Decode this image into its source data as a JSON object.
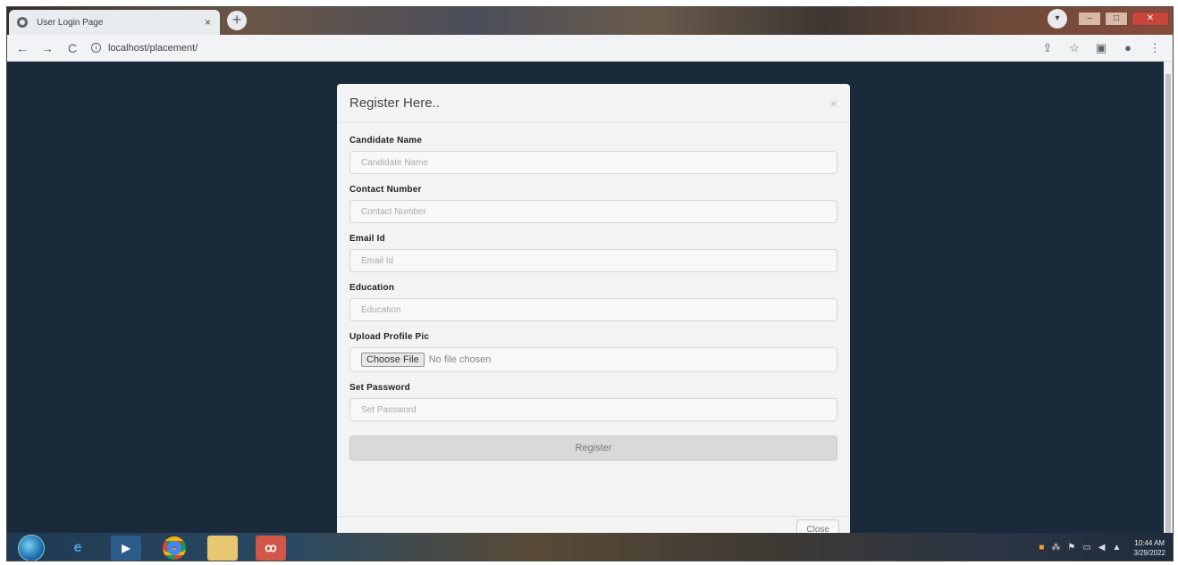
{
  "browser": {
    "tab_title": "User Login Page",
    "tab_close": "×",
    "new_tab": "+",
    "url": "localhost/placement/",
    "nav": {
      "back": "←",
      "forward": "→",
      "reload": "C"
    },
    "window_controls": {
      "minimize": "–",
      "maximize": "□",
      "close": "✕"
    }
  },
  "modal": {
    "title": "Register Here..",
    "close_symbol": "×",
    "fields": [
      {
        "label": "Candidate Name",
        "placeholder": "Candidate Name"
      },
      {
        "label": "Contact Number",
        "placeholder": "Contact Number"
      },
      {
        "label": "Email Id",
        "placeholder": "Email Id"
      },
      {
        "label": "Education",
        "placeholder": "Education"
      }
    ],
    "upload": {
      "label": "Upload Profile Pic",
      "button": "Choose File",
      "status": "No file chosen"
    },
    "password": {
      "label": "Set Password",
      "placeholder": "Set Password"
    },
    "submit": "Register",
    "footer_close": "Close"
  },
  "taskbar": {
    "time": "10:44 AM",
    "date": "3/29/2022"
  },
  "colors": {
    "page_background": "#1b2a3b",
    "modal_background": "#f3f3f3"
  }
}
